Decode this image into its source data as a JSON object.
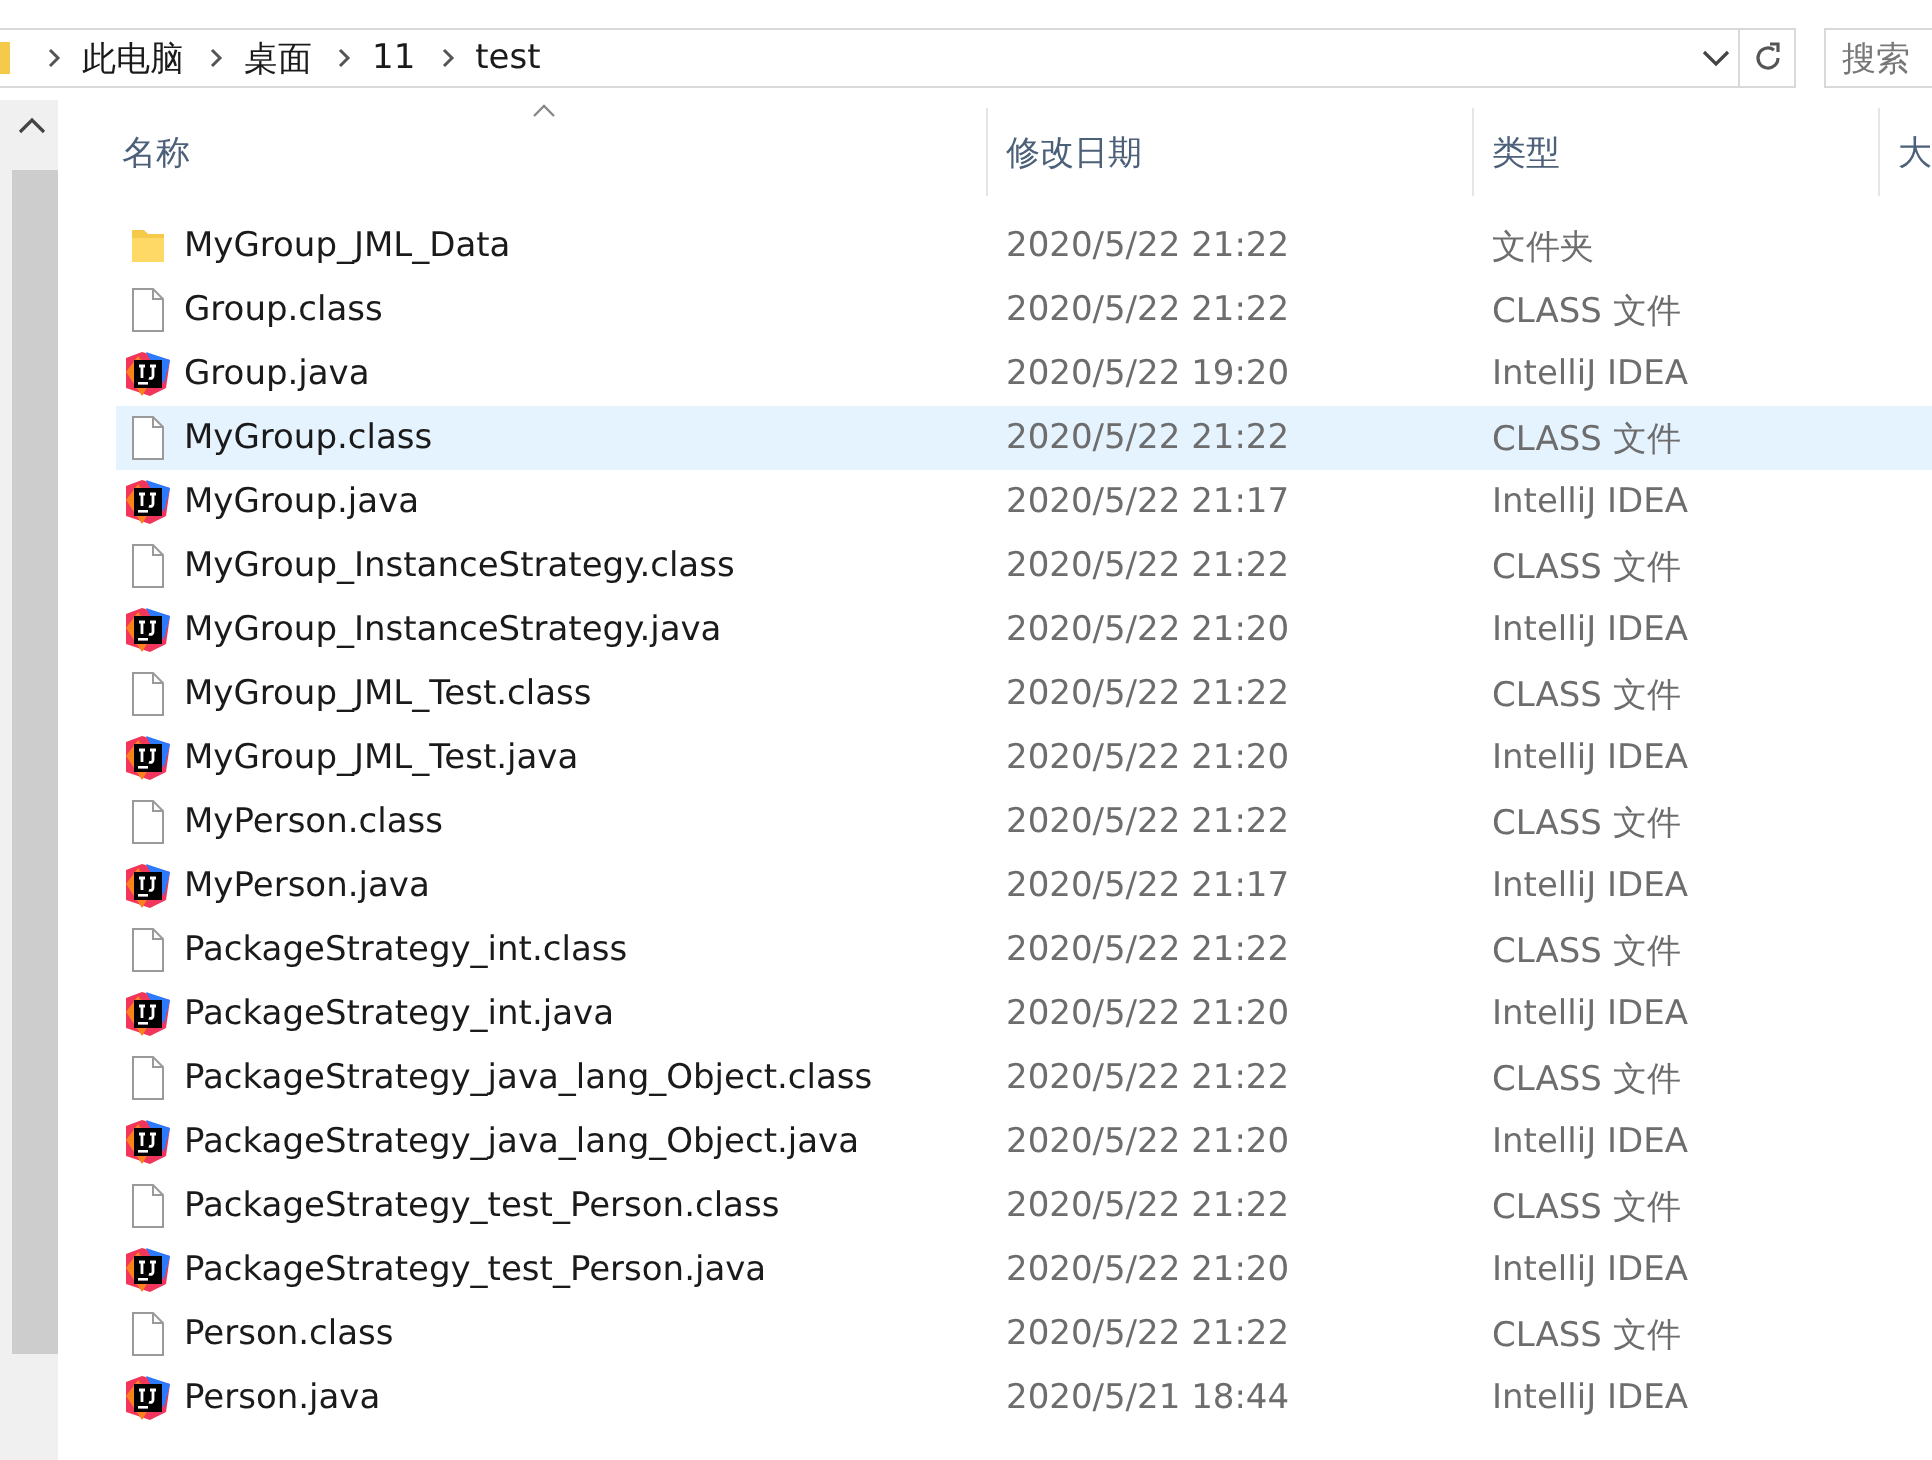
{
  "address_bar": {
    "path": [
      "此电脑",
      "桌面",
      "11",
      "test"
    ]
  },
  "search": {
    "placeholder": "搜索"
  },
  "columns": [
    {
      "label": "名称",
      "sorted": true
    },
    {
      "label": "修改日期",
      "sorted": false
    },
    {
      "label": "类型",
      "sorted": false
    },
    {
      "label": "大",
      "sorted": false
    }
  ],
  "files": [
    {
      "kind": "folder",
      "name": "MyGroup_JML_Data",
      "modified": "2020/5/22 21:22",
      "type": "文件夹",
      "selected": false
    },
    {
      "kind": "class",
      "name": "Group.class",
      "modified": "2020/5/22 21:22",
      "type": "CLASS 文件",
      "selected": false
    },
    {
      "kind": "java",
      "name": "Group.java",
      "modified": "2020/5/22 19:20",
      "type": "IntelliJ IDEA",
      "selected": false
    },
    {
      "kind": "class",
      "name": "MyGroup.class",
      "modified": "2020/5/22 21:22",
      "type": "CLASS 文件",
      "selected": true
    },
    {
      "kind": "java",
      "name": "MyGroup.java",
      "modified": "2020/5/22 21:17",
      "type": "IntelliJ IDEA",
      "selected": false
    },
    {
      "kind": "class",
      "name": "MyGroup_InstanceStrategy.class",
      "modified": "2020/5/22 21:22",
      "type": "CLASS 文件",
      "selected": false
    },
    {
      "kind": "java",
      "name": "MyGroup_InstanceStrategy.java",
      "modified": "2020/5/22 21:20",
      "type": "IntelliJ IDEA",
      "selected": false
    },
    {
      "kind": "class",
      "name": "MyGroup_JML_Test.class",
      "modified": "2020/5/22 21:22",
      "type": "CLASS 文件",
      "selected": false
    },
    {
      "kind": "java",
      "name": "MyGroup_JML_Test.java",
      "modified": "2020/5/22 21:20",
      "type": "IntelliJ IDEA",
      "selected": false
    },
    {
      "kind": "class",
      "name": "MyPerson.class",
      "modified": "2020/5/22 21:22",
      "type": "CLASS 文件",
      "selected": false
    },
    {
      "kind": "java",
      "name": "MyPerson.java",
      "modified": "2020/5/22 21:17",
      "type": "IntelliJ IDEA",
      "selected": false
    },
    {
      "kind": "class",
      "name": "PackageStrategy_int.class",
      "modified": "2020/5/22 21:22",
      "type": "CLASS 文件",
      "selected": false
    },
    {
      "kind": "java",
      "name": "PackageStrategy_int.java",
      "modified": "2020/5/22 21:20",
      "type": "IntelliJ IDEA",
      "selected": false
    },
    {
      "kind": "class",
      "name": "PackageStrategy_java_lang_Object.class",
      "modified": "2020/5/22 21:22",
      "type": "CLASS 文件",
      "selected": false
    },
    {
      "kind": "java",
      "name": "PackageStrategy_java_lang_Object.java",
      "modified": "2020/5/22 21:20",
      "type": "IntelliJ IDEA",
      "selected": false
    },
    {
      "kind": "class",
      "name": "PackageStrategy_test_Person.class",
      "modified": "2020/5/22 21:22",
      "type": "CLASS 文件",
      "selected": false
    },
    {
      "kind": "java",
      "name": "PackageStrategy_test_Person.java",
      "modified": "2020/5/22 21:20",
      "type": "IntelliJ IDEA",
      "selected": false
    },
    {
      "kind": "class",
      "name": "Person.class",
      "modified": "2020/5/22 21:22",
      "type": "CLASS 文件",
      "selected": false
    },
    {
      "kind": "java",
      "name": "Person.java",
      "modified": "2020/5/21 18:44",
      "type": "IntelliJ IDEA",
      "selected": false
    }
  ]
}
